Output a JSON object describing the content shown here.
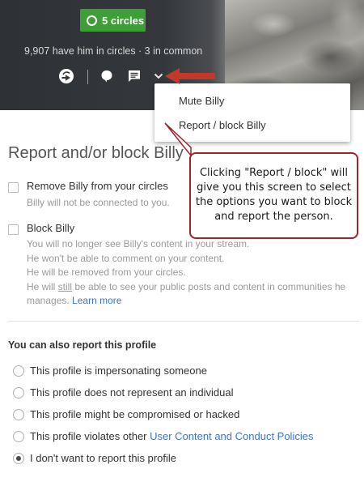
{
  "header": {
    "circles_button": "5 circles",
    "stats": "9,907 have him in circles · 3 in common"
  },
  "toolbar": {
    "icons": [
      "circles-add-icon",
      "comment-bubble-icon",
      "message-icon",
      "chevron-down-icon"
    ]
  },
  "menu": {
    "items": [
      {
        "label": "Mute Billy"
      },
      {
        "label": "Report / block Billy"
      }
    ]
  },
  "callout": {
    "text": "Clicking \"Report / block\" will give you this screen to select the options you want to block and report the person.",
    "border_color": "#a1242a"
  },
  "dialog": {
    "title": "Report and/or block Billy",
    "remove": {
      "label": "Remove Billy from your circles",
      "desc": "Billy will not be connected to you."
    },
    "block": {
      "label": "Block Billy",
      "desc_lines": [
        "You will no longer see Billy's content in your stream.",
        "He won't be able to comment on your content.",
        "He will be removed from your circles."
      ],
      "desc_last_pre": "He will ",
      "desc_last_still": "still",
      "desc_last_post": " be able to see your public posts and content in communities he manages.",
      "learn_more": "Learn more"
    },
    "report_section": {
      "title": "You can also report this profile",
      "options": [
        {
          "label": "This profile is impersonating someone"
        },
        {
          "label": "This profile does not represent an individual"
        },
        {
          "label": "This profile might be compromised or hacked"
        },
        {
          "label_pre": "This profile violates other ",
          "link": "User Content and Conduct Policies"
        },
        {
          "label": "I don't want to report this profile",
          "selected": true
        }
      ]
    }
  },
  "colors": {
    "accent_green": "#3e9e38",
    "link_blue": "#3b73d6",
    "arrow_red": "#c0392b"
  }
}
